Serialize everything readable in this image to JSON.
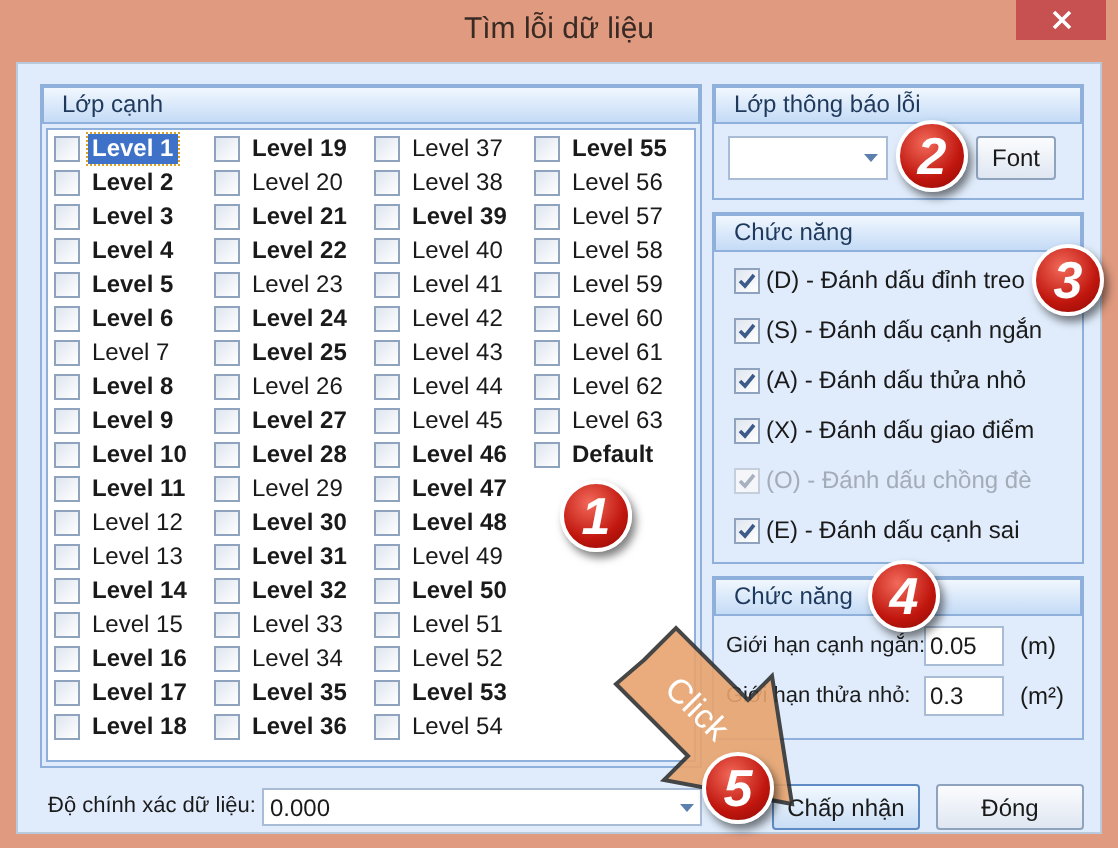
{
  "window": {
    "title": "Tìm lỗi dữ liệu"
  },
  "edge_layers": {
    "title": "Lớp cạnh",
    "items": [
      {
        "label": "Level 1",
        "bold": true,
        "checked": false,
        "selected": true
      },
      {
        "label": "Level 2",
        "bold": true,
        "checked": false,
        "selected": false
      },
      {
        "label": "Level 3",
        "bold": true,
        "checked": false,
        "selected": false
      },
      {
        "label": "Level 4",
        "bold": true,
        "checked": false,
        "selected": false
      },
      {
        "label": "Level 5",
        "bold": true,
        "checked": false,
        "selected": false
      },
      {
        "label": "Level 6",
        "bold": true,
        "checked": false,
        "selected": false
      },
      {
        "label": "Level 7",
        "bold": false,
        "checked": false,
        "selected": false
      },
      {
        "label": "Level 8",
        "bold": true,
        "checked": false,
        "selected": false
      },
      {
        "label": "Level 9",
        "bold": true,
        "checked": false,
        "selected": false
      },
      {
        "label": "Level 10",
        "bold": true,
        "checked": false,
        "selected": false
      },
      {
        "label": "Level 11",
        "bold": true,
        "checked": false,
        "selected": false
      },
      {
        "label": "Level 12",
        "bold": false,
        "checked": false,
        "selected": false
      },
      {
        "label": "Level 13",
        "bold": false,
        "checked": false,
        "selected": false
      },
      {
        "label": "Level 14",
        "bold": true,
        "checked": false,
        "selected": false
      },
      {
        "label": "Level 15",
        "bold": false,
        "checked": false,
        "selected": false
      },
      {
        "label": "Level 16",
        "bold": true,
        "checked": false,
        "selected": false
      },
      {
        "label": "Level 17",
        "bold": true,
        "checked": false,
        "selected": false
      },
      {
        "label": "Level 18",
        "bold": true,
        "checked": false,
        "selected": false
      },
      {
        "label": "Level 19",
        "bold": true,
        "checked": false,
        "selected": false
      },
      {
        "label": "Level 20",
        "bold": false,
        "checked": false,
        "selected": false
      },
      {
        "label": "Level 21",
        "bold": true,
        "checked": false,
        "selected": false
      },
      {
        "label": "Level 22",
        "bold": true,
        "checked": false,
        "selected": false
      },
      {
        "label": "Level 23",
        "bold": false,
        "checked": false,
        "selected": false
      },
      {
        "label": "Level 24",
        "bold": true,
        "checked": false,
        "selected": false
      },
      {
        "label": "Level 25",
        "bold": true,
        "checked": false,
        "selected": false
      },
      {
        "label": "Level 26",
        "bold": false,
        "checked": false,
        "selected": false
      },
      {
        "label": "Level 27",
        "bold": true,
        "checked": false,
        "selected": false
      },
      {
        "label": "Level 28",
        "bold": true,
        "checked": false,
        "selected": false
      },
      {
        "label": "Level 29",
        "bold": false,
        "checked": false,
        "selected": false
      },
      {
        "label": "Level 30",
        "bold": true,
        "checked": false,
        "selected": false
      },
      {
        "label": "Level 31",
        "bold": true,
        "checked": false,
        "selected": false
      },
      {
        "label": "Level 32",
        "bold": true,
        "checked": false,
        "selected": false
      },
      {
        "label": "Level 33",
        "bold": false,
        "checked": false,
        "selected": false
      },
      {
        "label": "Level 34",
        "bold": false,
        "checked": false,
        "selected": false
      },
      {
        "label": "Level 35",
        "bold": true,
        "checked": false,
        "selected": false
      },
      {
        "label": "Level 36",
        "bold": true,
        "checked": false,
        "selected": false
      },
      {
        "label": "Level 37",
        "bold": false,
        "checked": false,
        "selected": false
      },
      {
        "label": "Level 38",
        "bold": false,
        "checked": false,
        "selected": false
      },
      {
        "label": "Level 39",
        "bold": true,
        "checked": false,
        "selected": false
      },
      {
        "label": "Level 40",
        "bold": false,
        "checked": false,
        "selected": false
      },
      {
        "label": "Level 41",
        "bold": false,
        "checked": false,
        "selected": false
      },
      {
        "label": "Level 42",
        "bold": false,
        "checked": false,
        "selected": false
      },
      {
        "label": "Level 43",
        "bold": false,
        "checked": false,
        "selected": false
      },
      {
        "label": "Level 44",
        "bold": false,
        "checked": false,
        "selected": false
      },
      {
        "label": "Level 45",
        "bold": false,
        "checked": false,
        "selected": false
      },
      {
        "label": "Level 46",
        "bold": true,
        "checked": false,
        "selected": false
      },
      {
        "label": "Level 47",
        "bold": true,
        "checked": false,
        "selected": false
      },
      {
        "label": "Level 48",
        "bold": true,
        "checked": false,
        "selected": false
      },
      {
        "label": "Level 49",
        "bold": false,
        "checked": false,
        "selected": false
      },
      {
        "label": "Level 50",
        "bold": true,
        "checked": false,
        "selected": false
      },
      {
        "label": "Level 51",
        "bold": false,
        "checked": false,
        "selected": false
      },
      {
        "label": "Level 52",
        "bold": false,
        "checked": false,
        "selected": false
      },
      {
        "label": "Level 53",
        "bold": true,
        "checked": false,
        "selected": false
      },
      {
        "label": "Level 54",
        "bold": false,
        "checked": false,
        "selected": false
      },
      {
        "label": "Level 55",
        "bold": true,
        "checked": false,
        "selected": false
      },
      {
        "label": "Level 56",
        "bold": false,
        "checked": false,
        "selected": false
      },
      {
        "label": "Level 57",
        "bold": false,
        "checked": false,
        "selected": false
      },
      {
        "label": "Level 58",
        "bold": false,
        "checked": false,
        "selected": false
      },
      {
        "label": "Level 59",
        "bold": false,
        "checked": false,
        "selected": false
      },
      {
        "label": "Level 60",
        "bold": false,
        "checked": false,
        "selected": false
      },
      {
        "label": "Level 61",
        "bold": false,
        "checked": false,
        "selected": false
      },
      {
        "label": "Level 62",
        "bold": false,
        "checked": false,
        "selected": false
      },
      {
        "label": "Level 63",
        "bold": false,
        "checked": false,
        "selected": false
      },
      {
        "label": "Default",
        "bold": true,
        "checked": false,
        "selected": false
      }
    ]
  },
  "error_layer": {
    "title": "Lớp thông báo lỗi",
    "font_button": "Font"
  },
  "functions": {
    "title": "Chức năng",
    "items": [
      {
        "label": "(D) - Đánh dấu đỉnh treo",
        "checked": true,
        "disabled": false
      },
      {
        "label": "(S) - Đánh dấu cạnh ngắn",
        "checked": true,
        "disabled": false
      },
      {
        "label": "(A) - Đánh dấu thửa nhỏ",
        "checked": true,
        "disabled": false
      },
      {
        "label": "(X) - Đánh dấu giao điểm",
        "checked": true,
        "disabled": false
      },
      {
        "label": "(O) - Đánh dấu chồng đè",
        "checked": true,
        "disabled": true
      },
      {
        "label": "(E) - Đánh dấu cạnh sai",
        "checked": true,
        "disabled": false
      }
    ]
  },
  "limits": {
    "title": "Chức năng",
    "rows": [
      {
        "label": "Giới hạn cạnh ngắn:",
        "value": "0.05",
        "unit": "(m)"
      },
      {
        "label": "Giới hạn thửa nhỏ:",
        "value": "0.3",
        "unit": "(m²)"
      }
    ]
  },
  "precision": {
    "label": "Độ chính xác dữ liệu:",
    "value": "0.000"
  },
  "buttons": [
    {
      "label": "Chấp nhận",
      "focused": true
    },
    {
      "label": "Đóng",
      "focused": false
    }
  ],
  "annotations": {
    "badges": [
      "1",
      "2",
      "3",
      "4",
      "5"
    ],
    "arrow_text": "Click"
  }
}
